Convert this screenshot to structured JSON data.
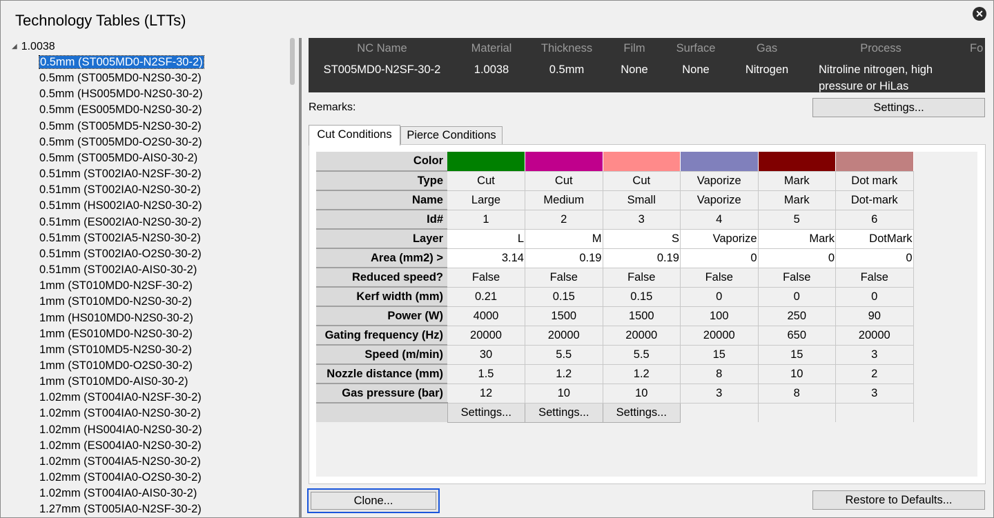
{
  "window": {
    "title": "Technology Tables (LTTs)",
    "close_icon": "close-icon"
  },
  "tree": {
    "root": "1.0038",
    "items": [
      "0.5mm (ST005MD0-N2SF-30-2)",
      "0.5mm (ST005MD0-N2S0-30-2)",
      "0.5mm (HS005MD0-N2S0-30-2)",
      "0.5mm (ES005MD0-N2S0-30-2)",
      "0.5mm (ST005MD5-N2S0-30-2)",
      "0.5mm (ST005MD0-O2S0-30-2)",
      "0.5mm (ST005MD0-AIS0-30-2)",
      "0.51mm (ST002IA0-N2SF-30-2)",
      "0.51mm (ST002IA0-N2S0-30-2)",
      "0.51mm (HS002IA0-N2S0-30-2)",
      "0.51mm (ES002IA0-N2S0-30-2)",
      "0.51mm (ST002IA5-N2S0-30-2)",
      "0.51mm (ST002IA0-O2S0-30-2)",
      "0.51mm (ST002IA0-AIS0-30-2)",
      "1mm (ST010MD0-N2SF-30-2)",
      "1mm (ST010MD0-N2S0-30-2)",
      "1mm (HS010MD0-N2S0-30-2)",
      "1mm (ES010MD0-N2S0-30-2)",
      "1mm (ST010MD5-N2S0-30-2)",
      "1mm (ST010MD0-O2S0-30-2)",
      "1mm (ST010MD0-AIS0-30-2)",
      "1.02mm (ST004IA0-N2SF-30-2)",
      "1.02mm (ST004IA0-N2S0-30-2)",
      "1.02mm (HS004IA0-N2S0-30-2)",
      "1.02mm (ES004IA0-N2S0-30-2)",
      "1.02mm (ST004IA5-N2S0-30-2)",
      "1.02mm (ST004IA0-O2S0-30-2)",
      "1.02mm (ST004IA0-AIS0-30-2)",
      "1.27mm (ST005IA0-N2SF-30-2)"
    ],
    "selected_index": 0
  },
  "header": {
    "nc_name": {
      "label": "NC Name",
      "value": "ST005MD0-N2SF-30-2"
    },
    "material": {
      "label": "Material",
      "value": "1.0038"
    },
    "thickness": {
      "label": "Thickness",
      "value": "0.5mm"
    },
    "film": {
      "label": "Film",
      "value": "None"
    },
    "surface": {
      "label": "Surface",
      "value": "None"
    },
    "gas": {
      "label": "Gas",
      "value": "Nitrogen"
    },
    "process": {
      "label": "Process",
      "value_line1": "Nitroline nitrogen, high",
      "value_line2": "pressure or HiLas"
    },
    "focus": {
      "label": "Fo"
    }
  },
  "remarks_label": "Remarks:",
  "settings_button": "Settings...",
  "tabs": {
    "cut": "Cut Conditions",
    "pierce": "Pierce Conditions"
  },
  "conditions": {
    "row_labels": {
      "color": "Color",
      "type": "Type",
      "name": "Name",
      "id": "Id#",
      "layer": "Layer",
      "area": "Area (mm2) >",
      "reduced": "Reduced speed?",
      "kerf": "Kerf width (mm)",
      "power": "Power (W)",
      "gating": "Gating frequency (Hz)",
      "speed": "Speed (m/min)",
      "nozzle": "Nozzle distance (mm)",
      "gas": "Gas pressure (bar)"
    },
    "columns": [
      {
        "color": "#008000",
        "type": "Cut",
        "name": "Large",
        "id": "1",
        "layer": "L",
        "area": "3.14",
        "reduced": "False",
        "kerf": "0.21",
        "power": "4000",
        "gating": "20000",
        "speed": "30",
        "nozzle": "1.5",
        "gas": "12",
        "settings": "Settings..."
      },
      {
        "color": "#c0008c",
        "type": "Cut",
        "name": "Medium",
        "id": "2",
        "layer": "M",
        "area": "0.19",
        "reduced": "False",
        "kerf": "0.15",
        "power": "1500",
        "gating": "20000",
        "speed": "5.5",
        "nozzle": "1.2",
        "gas": "10",
        "settings": "Settings..."
      },
      {
        "color": "#ff8a8a",
        "type": "Cut",
        "name": "Small",
        "id": "3",
        "layer": "S",
        "area": "0.19",
        "reduced": "False",
        "kerf": "0.15",
        "power": "1500",
        "gating": "20000",
        "speed": "5.5",
        "nozzle": "1.2",
        "gas": "10",
        "settings": "Settings..."
      },
      {
        "color": "#8080bc",
        "type": "Vaporize",
        "name": "Vaporize",
        "id": "4",
        "layer": "Vaporize",
        "area": "0",
        "reduced": "False",
        "kerf": "0",
        "power": "100",
        "gating": "20000",
        "speed": "15",
        "nozzle": "8",
        "gas": "3",
        "settings": ""
      },
      {
        "color": "#800000",
        "type": "Mark",
        "name": "Mark",
        "id": "5",
        "layer": "Mark",
        "area": "0",
        "reduced": "False",
        "kerf": "0",
        "power": "250",
        "gating": "650",
        "speed": "15",
        "nozzle": "10",
        "gas": "8",
        "settings": ""
      },
      {
        "color": "#c08080",
        "type": "Dot mark",
        "name": "Dot-mark",
        "id": "6",
        "layer": "DotMark",
        "area": "0",
        "reduced": "False",
        "kerf": "0",
        "power": "90",
        "gating": "20000",
        "speed": "3",
        "nozzle": "2",
        "gas": "3",
        "settings": ""
      }
    ]
  },
  "footer": {
    "clone": "Clone...",
    "restore": "Restore to Defaults..."
  }
}
